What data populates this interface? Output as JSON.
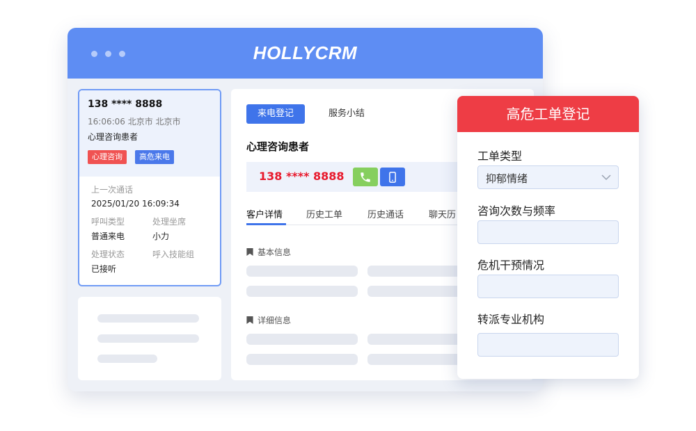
{
  "window": {
    "brand": "HOLLYCRM"
  },
  "contact": {
    "phone": "138 **** 8888",
    "time_location": "16:06:06  北京市 北京市",
    "name": "心理咨询患者",
    "tags": [
      "心理咨询",
      "高危来电"
    ],
    "last_call_label": "上一次通话",
    "last_call_value": "2025/01/20   16:09:34",
    "call_type_label": "呼叫类型",
    "call_type_value": "普通来电",
    "agent_label": "处理坐席",
    "agent_value": "小力",
    "status_label": "处理状态",
    "status_value": "已接听",
    "skill_group_label": "呼入技能组"
  },
  "main": {
    "buttons": {
      "register": "来电登记",
      "summary": "服务小结"
    },
    "title": "心理咨询患者",
    "phone": "138 **** 8888",
    "tabs": [
      "客户详情",
      "历史工单",
      "历史通话",
      "聊天历"
    ],
    "sections": {
      "basic": "基本信息",
      "detail": "详细信息"
    }
  },
  "panel": {
    "title": "高危工单登记",
    "fields": [
      {
        "label": "工单类型",
        "value": "抑郁情绪"
      },
      {
        "label": "咨询次数与频率",
        "value": ""
      },
      {
        "label": "危机干预情况",
        "value": ""
      },
      {
        "label": "转派专业机构",
        "value": ""
      }
    ]
  },
  "colors": {
    "header_blue": "#5e8df3",
    "primary": "#3f74ea",
    "danger": "#ee3d45",
    "phone_red": "#e8192c",
    "call_green": "#86cf5e"
  },
  "icons": [
    "window-dot-icon",
    "phone-call-icon",
    "mobile-icon",
    "bookmark-icon",
    "chevron-down-icon"
  ]
}
